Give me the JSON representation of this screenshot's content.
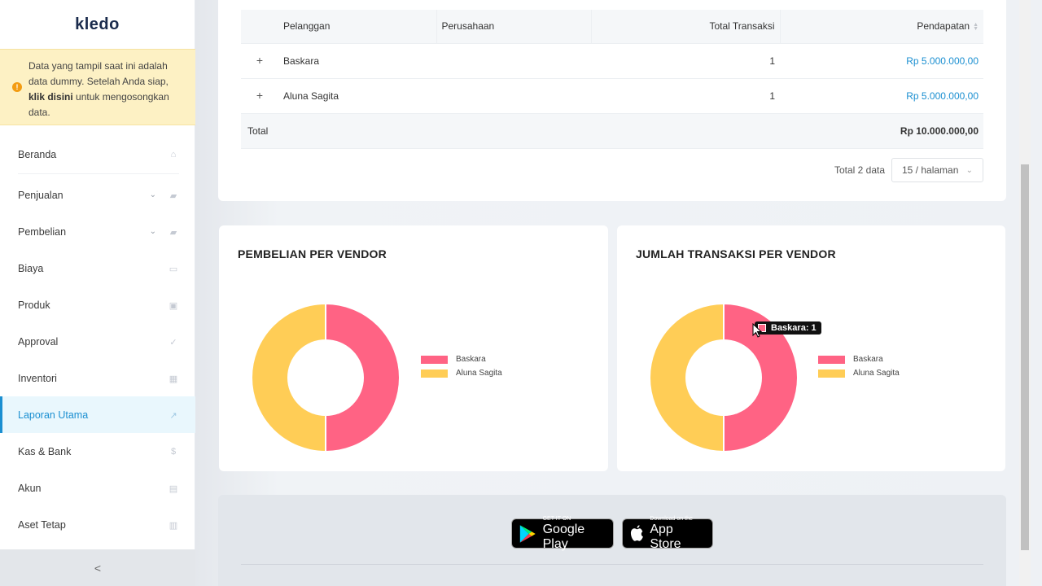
{
  "sidebar": {
    "logo": "kledo",
    "notice": {
      "text_before": "Data yang tampil saat ini adalah data dummy. Setelah Anda siap,",
      "link": "klik disini",
      "text_after": "untuk mengosongkan data."
    },
    "items": [
      {
        "label": "Beranda",
        "icon": "home-icon"
      },
      {
        "label": "Penjualan",
        "icon": "basket-icon"
      },
      {
        "label": "Pembelian",
        "icon": "bag-icon"
      },
      {
        "label": "Biaya",
        "icon": "card-icon"
      },
      {
        "label": "Produk",
        "icon": "box-icon"
      },
      {
        "label": "Approval",
        "icon": "check-icon"
      },
      {
        "label": "Inventori",
        "icon": "warehouse-icon"
      },
      {
        "label": "Laporan Utama",
        "icon": "chart-icon"
      },
      {
        "label": "Kas & Bank",
        "icon": "dollar-icon"
      },
      {
        "label": "Akun",
        "icon": "ledger-icon"
      },
      {
        "label": "Aset Tetap",
        "icon": "building-icon"
      }
    ],
    "collapse_label": "<"
  },
  "table": {
    "headers": {
      "pelanggan": "Pelanggan",
      "perusahaan": "Perusahaan",
      "total_transaksi": "Total Transaksi",
      "pendapatan": "Pendapatan"
    },
    "rows": [
      {
        "pelanggan": "Baskara",
        "perusahaan": "",
        "total_transaksi": "1",
        "pendapatan": "Rp 5.000.000,00"
      },
      {
        "pelanggan": "Aluna Sagita",
        "perusahaan": "",
        "total_transaksi": "1",
        "pendapatan": "Rp 5.000.000,00"
      }
    ],
    "total_label": "Total",
    "total_value": "Rp 10.000.000,00",
    "pager_total": "Total 2 data",
    "pager_size": "15 / halaman"
  },
  "charts_ui": {
    "left_title": "PEMBELIAN PER VENDOR",
    "right_title": "JUMLAH TRANSAKSI PER VENDOR",
    "tooltip": "Baskara: 1"
  },
  "chart_data": [
    {
      "type": "pie",
      "title": "PEMBELIAN PER VENDOR",
      "categories": [
        "Baskara",
        "Aluna Sagita"
      ],
      "values": [
        5000000,
        5000000
      ],
      "colors": [
        "#ff6384",
        "#ffcd56"
      ],
      "legend": "right"
    },
    {
      "type": "pie",
      "title": "JUMLAH TRANSAKSI PER VENDOR",
      "categories": [
        "Baskara",
        "Aluna Sagita"
      ],
      "values": [
        1,
        1
      ],
      "colors": [
        "#ff6384",
        "#ffcd56"
      ],
      "legend": "right"
    }
  ],
  "footer": {
    "google_small": "GET IT ON",
    "google_big": "Google Play",
    "apple_small": "Download on the",
    "apple_big": "App Store"
  }
}
